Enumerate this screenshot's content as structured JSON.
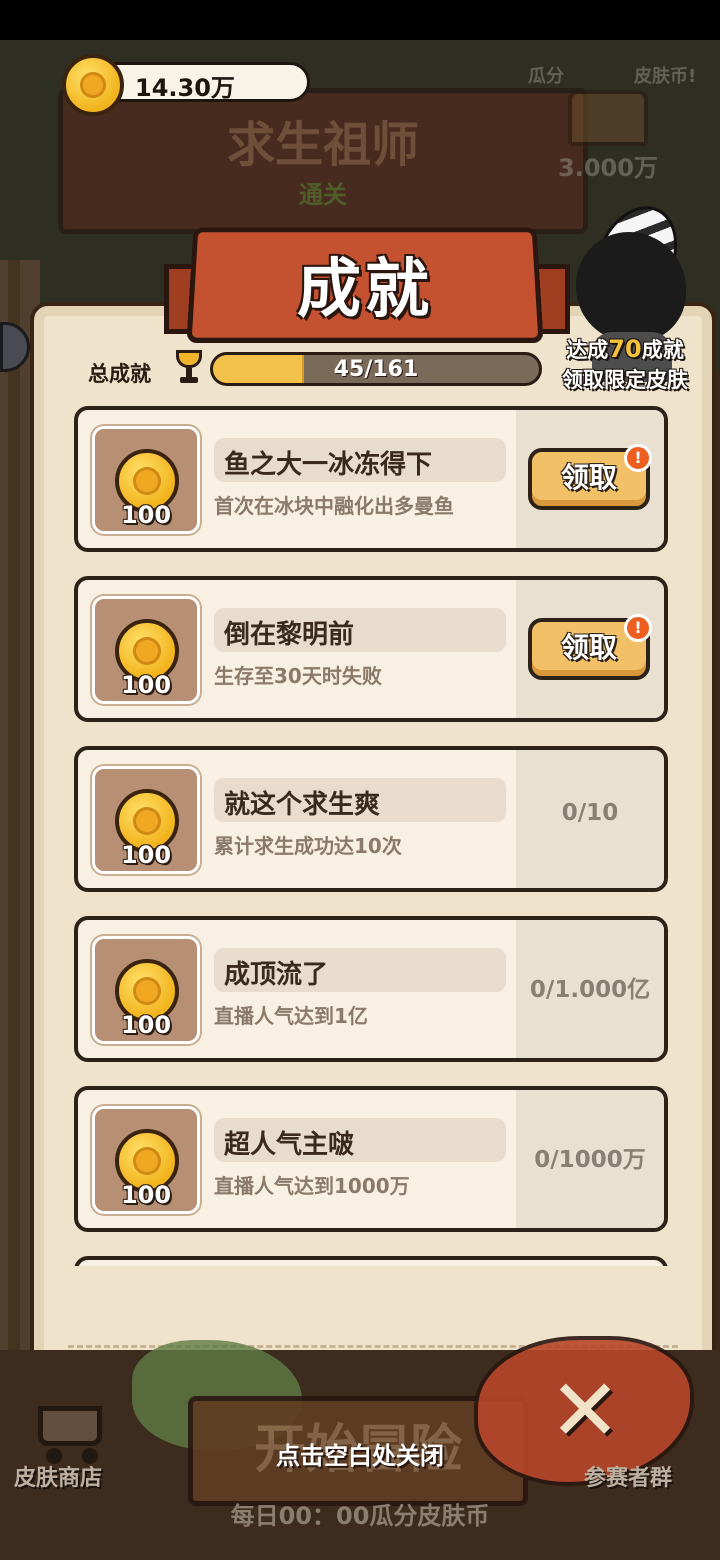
{
  "header": {
    "coins": "14.30万",
    "board_title": "求生祖师",
    "board_subtitle": "通关",
    "chest_label_left": "瓜分",
    "chest_label_right": "皮肤币!",
    "chest_amount": "3.000万"
  },
  "dialog": {
    "title": "成就",
    "total_label": "总成就",
    "progress_text": "45/161",
    "progress_fraction": 0.2795,
    "goal_line1_prefix": "达成",
    "goal_number": "70",
    "goal_line1_suffix": "成就",
    "goal_line2": "领取限定皮肤"
  },
  "achievements": [
    {
      "title": "鱼之大一冰冻得下",
      "desc": "首次在冰块中融化出多曼鱼",
      "reward": "100",
      "claim_label": "领取",
      "badge": "!",
      "progress": ""
    },
    {
      "title": "倒在黎明前",
      "desc": "生存至30天时失败",
      "reward": "100",
      "claim_label": "领取",
      "badge": "!",
      "progress": ""
    },
    {
      "title": "就这个求生爽",
      "desc": "累计求生成功达10次",
      "reward": "100",
      "claim_label": "",
      "badge": "",
      "progress": "0/10"
    },
    {
      "title": "成顶流了",
      "desc": "直播人气达到1亿",
      "reward": "100",
      "claim_label": "",
      "badge": "",
      "progress": "0/1.000亿"
    },
    {
      "title": "超人气主啵",
      "desc": "直播人气达到1000万",
      "reward": "100",
      "claim_label": "",
      "badge": "",
      "progress": "0/1000万"
    }
  ],
  "footer": {
    "start_button": "开始冒险",
    "tap_to_close": "点击空白处关闭",
    "shop_label": "皮肤商店",
    "group_label": "参赛者群",
    "daily_text": "每日00：00瓜分皮肤币"
  }
}
